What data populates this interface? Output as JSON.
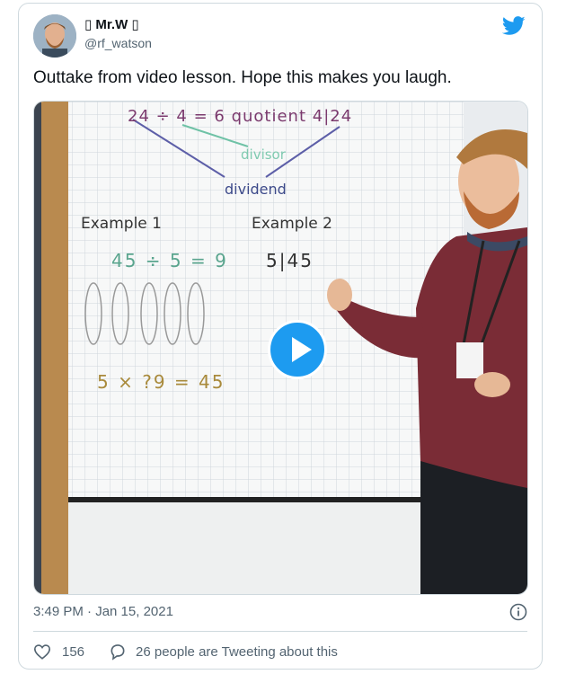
{
  "author": {
    "display_name": "▯ Mr.W ▯",
    "handle": "@rf_watson",
    "avatar_icon": "user-avatar"
  },
  "brand": {
    "icon": "twitter-bird-icon",
    "color": "#1d9bf0"
  },
  "tweet": {
    "text": "Outtake from video lesson. Hope this makes you laugh.",
    "timestamp": "3:49 PM · Jan 15, 2021"
  },
  "whiteboard": {
    "top_line": "24 ÷ 4 = 6 quotient 4|24",
    "divisor_label": "divisor",
    "dividend_label": "dividend",
    "example1_title": "Example 1",
    "example1_equation": "45 ÷ 5 = 9",
    "example1_check": "5 × ?9 = 45",
    "example2_title": "Example 2",
    "example2_longdiv": "5|45"
  },
  "video": {
    "play_icon": "play-icon"
  },
  "actions": {
    "like_count": "156",
    "reply_text": "26 people are Tweeting about this"
  }
}
